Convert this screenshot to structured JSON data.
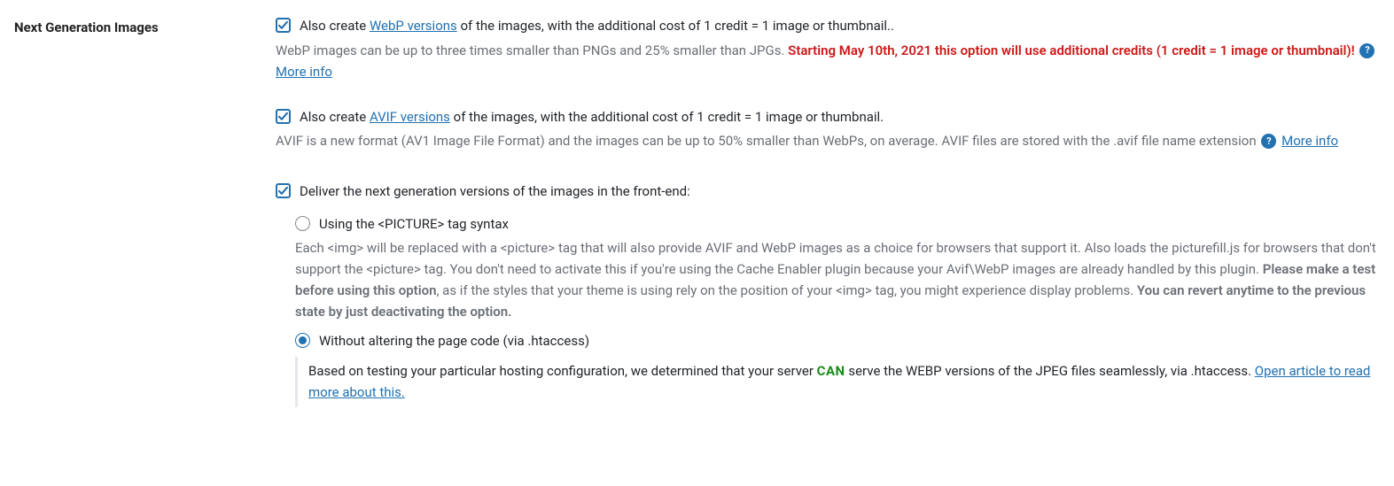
{
  "section": {
    "title": "Next Generation Images"
  },
  "webp": {
    "label_before": "Also create ",
    "link": "WebP versions",
    "label_after": " of the images, with the additional cost of 1 credit = 1 image or thumbnail..",
    "desc_before": "WebP images can be up to three times smaller than PNGs and 25% smaller than JPGs. ",
    "desc_red": "Starting May 10th, 2021 this option will use additional credits (1 credit = 1 image or thumbnail)!",
    "more_info": "More info"
  },
  "avif": {
    "label_before": "Also create ",
    "link": "AVIF versions",
    "label_after": " of the images, with the additional cost of 1 credit = 1 image or thumbnail.",
    "desc": "AVIF is a new format (AV1 Image File Format) and the images can be up to 50% smaller than WebPs, on average. AVIF files are stored with the .avif file name extension",
    "more_info": "More info"
  },
  "deliver": {
    "label": "Deliver the next generation versions of the images in the front-end:",
    "picture": {
      "label": "Using the <PICTURE> tag syntax",
      "desc_a": "Each <img> will be replaced with a <picture> tag that will also provide AVIF and WebP images as a choice for browsers that support it. Also loads the picturefill.js for browsers that don't support the <picture> tag. You don't need to activate this if you're using the Cache Enabler plugin because your Avif\\WebP images are already handled by this plugin. ",
      "desc_bold1": "Please make a test before using this option",
      "desc_b": ", as if the styles that your theme is using rely on the position of your <img> tag, you might experience display problems. ",
      "desc_bold2": "You can revert anytime to the previous state by just deactivating the option."
    },
    "htaccess": {
      "label": "Without altering the page code (via .htaccess)",
      "msg_a": "Based on testing your particular hosting configuration, we determined that your server ",
      "can": "CAN",
      "msg_b": " serve the WEBP versions of the JPEG files seamlessly, via .htaccess. ",
      "link": "Open article to read more about this."
    }
  },
  "info_glyph": "?"
}
